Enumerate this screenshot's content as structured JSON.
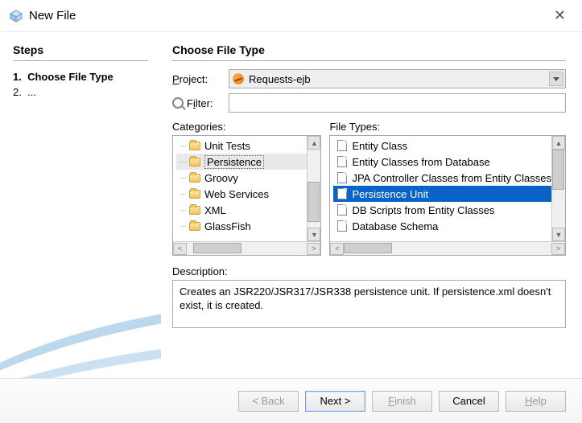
{
  "window": {
    "title": "New File"
  },
  "steps": {
    "header": "Steps",
    "items": [
      {
        "n": "1.",
        "label": "Choose File Type",
        "current": true
      },
      {
        "n": "2.",
        "label": "..."
      }
    ]
  },
  "panel": {
    "header": "Choose File Type",
    "projectLabel_pre": "P",
    "projectLabel_post": "roject:",
    "projectValue": "Requests-ejb",
    "filterLabel_pre": "F",
    "filterLabel_mid": "i",
    "filterLabel_post": "lter:",
    "filterValue": "",
    "categoriesLabel_pre": "C",
    "categoriesLabel_post": "ategories:",
    "fileTypesLabel_pre": "F",
    "fileTypesLabel_post": "ile Types:",
    "descriptionLabel_pre": "D",
    "descriptionLabel_post": "escription:",
    "description": "Creates an JSR220/JSR317/JSR338 persistence unit. If persistence.xml doesn't exist, it is created."
  },
  "categories": [
    {
      "label": "Unit Tests"
    },
    {
      "label": "Persistence",
      "selected": true
    },
    {
      "label": "Groovy"
    },
    {
      "label": "Web Services"
    },
    {
      "label": "XML"
    },
    {
      "label": "GlassFish"
    }
  ],
  "fileTypes": [
    {
      "label": "Entity Class"
    },
    {
      "label": "Entity Classes from Database"
    },
    {
      "label": "JPA Controller Classes from Entity Classes"
    },
    {
      "label": "Persistence Unit",
      "selected": true
    },
    {
      "label": "DB Scripts from Entity Classes"
    },
    {
      "label": "Database Schema"
    }
  ],
  "buttons": {
    "back": "< Back",
    "next": "Next >",
    "finish": "Finish",
    "cancel": "Cancel",
    "help": "Help"
  }
}
